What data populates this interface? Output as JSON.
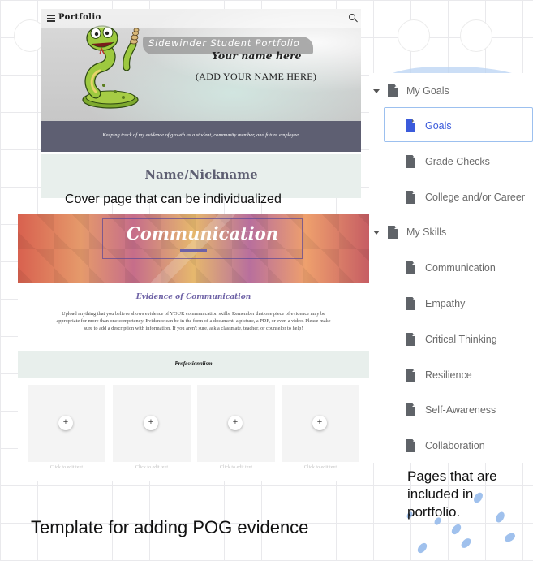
{
  "cover": {
    "site_title": "Portfolio",
    "script_title": "Sidewinder Student Portfolio",
    "your_name": "Your name here",
    "add_name": "(ADD YOUR NAME HERE)",
    "tagline": "Keeping track of my evidence of growth as a student, community member, and future employee.",
    "nickname": "Name/Nickname"
  },
  "captions": {
    "cover": "Cover page that can be individualized",
    "template": "Template for adding POG evidence",
    "pages": "Pages that are included in portfolio."
  },
  "communication": {
    "hero_title": "Communication",
    "evidence_title": "Evidence of Communication",
    "evidence_body": "Upload anything that you believe shows evidence of YOUR communication skills. Remember that one piece of evidence may be appropriate for more than one competency. Evidence can be in the form of a document, a picture, a PDF, or even a video. Please make sure to add a description with information. If you aren't sure, ask a classmate, teacher, or counselor to help!",
    "section": "Professionalism",
    "cards": [
      {
        "plus": "+",
        "edit": "Click to edit text"
      },
      {
        "plus": "+",
        "edit": "Click to edit text"
      },
      {
        "plus": "+",
        "edit": "Click to edit text"
      },
      {
        "plus": "+",
        "edit": "Click to edit text"
      }
    ]
  },
  "sidebar": {
    "items": [
      {
        "label": "My Goals",
        "level": 0,
        "expanded": true
      },
      {
        "label": "Goals",
        "level": 1,
        "active": true
      },
      {
        "label": "Grade Checks",
        "level": 1
      },
      {
        "label": "College and/or Career",
        "level": 1
      },
      {
        "label": "My Skills",
        "level": 0,
        "expanded": true
      },
      {
        "label": "Communication",
        "level": 1
      },
      {
        "label": "Empathy",
        "level": 1
      },
      {
        "label": "Critical Thinking",
        "level": 1
      },
      {
        "label": "Resilience",
        "level": 1
      },
      {
        "label": "Self-Awareness",
        "level": 1
      },
      {
        "label": "Collaboration",
        "level": 1
      }
    ]
  },
  "colors": {
    "accent": "#3b5bdb",
    "slate": "#5e5f72",
    "mint": "#e8efec",
    "purple": "#6e62a6"
  },
  "icons": [
    "menu-icon",
    "search-icon",
    "snake-mascot-icon",
    "document-icon",
    "caret-down-icon",
    "plus-icon"
  ]
}
